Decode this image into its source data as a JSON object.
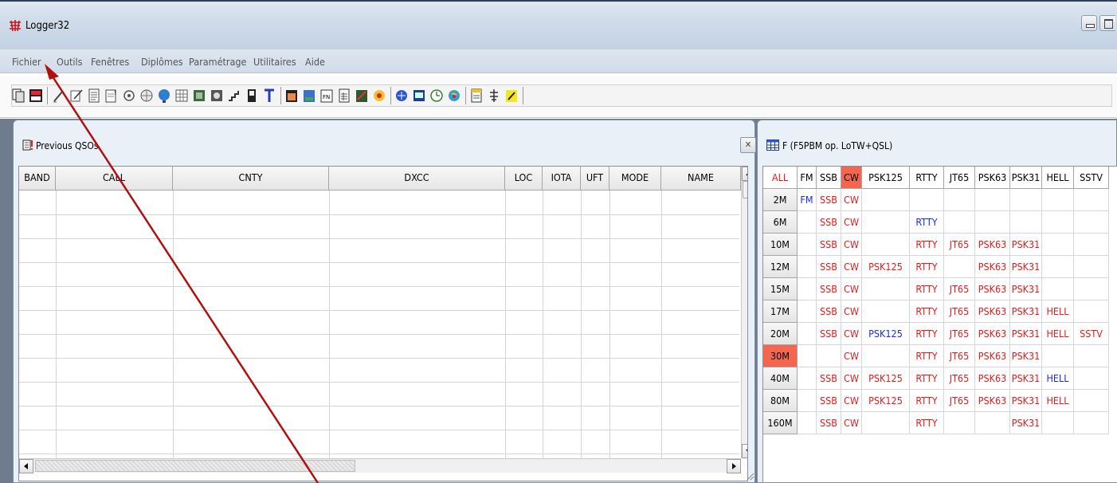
{
  "window": {
    "title": "Logger32"
  },
  "menu": [
    "Fichier",
    "Outils",
    "Fenêtres",
    "Diplômes",
    "Paramétrage",
    "Utilitaires",
    "Aide"
  ],
  "previous_qsos": {
    "title": "Previous QSOs",
    "columns": [
      "BAND",
      "CALL",
      "CNTY",
      "DXCC",
      "LOC",
      "IOTA",
      "UFT",
      "MODE",
      "NAME"
    ]
  },
  "countries": {
    "title": "F (F5PBM op. LoTW+QSL)",
    "columns": [
      "ALL",
      "FM",
      "SSB",
      "CW",
      "PSK125",
      "RTTY",
      "JT65",
      "PSK63",
      "PSK31",
      "HELL",
      "SSTV"
    ],
    "highlighted_column": "CW",
    "highlighted_band": "30M",
    "rows": [
      {
        "band": "2M",
        "cells": [
          "FM",
          "SSB",
          "CW",
          "",
          "",
          "",
          "",
          "",
          "",
          ""
        ]
      },
      {
        "band": "6M",
        "cells": [
          "",
          "SSB",
          "CW",
          "",
          "RTTY",
          "",
          "",
          "",
          "",
          ""
        ]
      },
      {
        "band": "10M",
        "cells": [
          "",
          "SSB",
          "CW",
          "",
          "RTTY",
          "JT65",
          "PSK63",
          "PSK31",
          "",
          ""
        ]
      },
      {
        "band": "12M",
        "cells": [
          "",
          "SSB",
          "CW",
          "PSK125",
          "RTTY",
          "",
          "PSK63",
          "PSK31",
          "",
          ""
        ]
      },
      {
        "band": "15M",
        "cells": [
          "",
          "SSB",
          "CW",
          "",
          "RTTY",
          "JT65",
          "PSK63",
          "PSK31",
          "",
          ""
        ]
      },
      {
        "band": "17M",
        "cells": [
          "",
          "SSB",
          "CW",
          "",
          "RTTY",
          "JT65",
          "PSK63",
          "PSK31",
          "HELL",
          ""
        ]
      },
      {
        "band": "20M",
        "cells": [
          "",
          "SSB",
          "CW",
          "PSK125",
          "RTTY",
          "JT65",
          "PSK63",
          "PSK31",
          "HELL",
          "SSTV"
        ]
      },
      {
        "band": "30M",
        "cells": [
          "",
          "",
          "CW",
          "",
          "RTTY",
          "JT65",
          "PSK63",
          "PSK31",
          "",
          ""
        ]
      },
      {
        "band": "40M",
        "cells": [
          "",
          "SSB",
          "CW",
          "PSK125",
          "RTTY",
          "JT65",
          "PSK63",
          "PSK31",
          "HELL",
          ""
        ]
      },
      {
        "band": "80M",
        "cells": [
          "",
          "SSB",
          "CW",
          "PSK125",
          "RTTY",
          "JT65",
          "PSK63",
          "PSK31",
          "HELL",
          ""
        ]
      },
      {
        "band": "160M",
        "cells": [
          "",
          "SSB",
          "CW",
          "",
          "RTTY",
          "",
          "",
          "PSK31",
          "",
          ""
        ]
      }
    ],
    "blue_cells": [
      [
        "2M",
        "FM"
      ],
      [
        "6M",
        "RTTY"
      ],
      [
        "20M",
        "PSK125"
      ],
      [
        "40M",
        "HELL"
      ]
    ]
  },
  "colors": {
    "confirmed": "#e31b1b",
    "worked": "#1a2ee0",
    "highlight": "#f4674e",
    "annotation_arrow": "#b01010"
  }
}
